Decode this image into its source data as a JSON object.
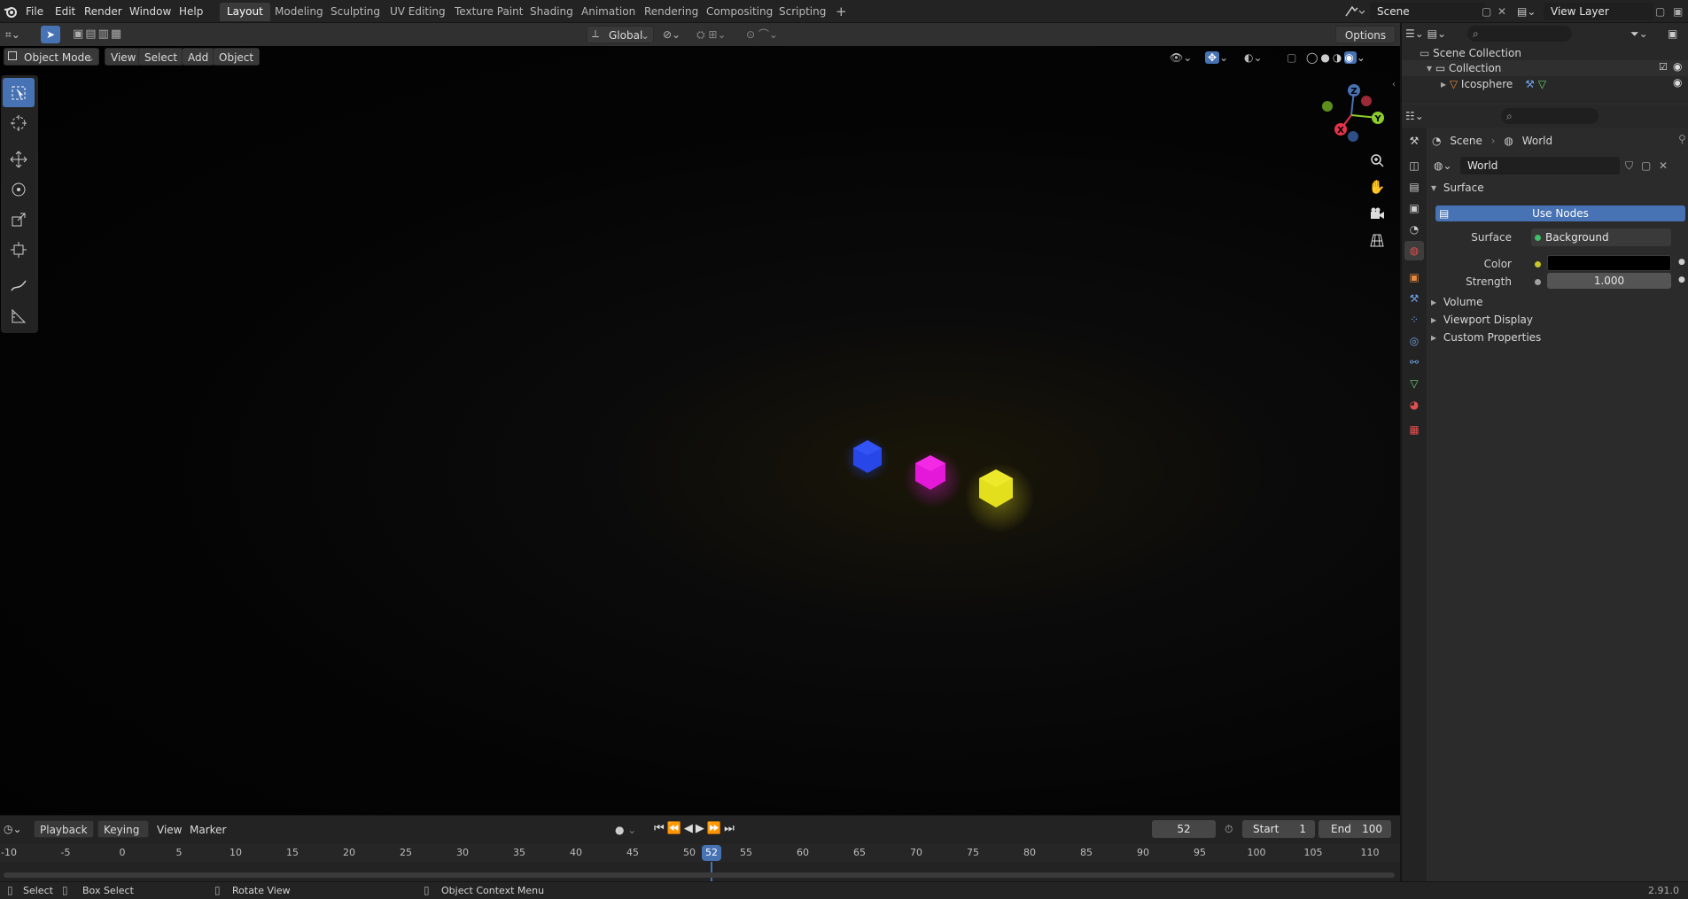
{
  "menubar": {
    "items": [
      "File",
      "Edit",
      "Render",
      "Window",
      "Help"
    ],
    "workspaces": [
      "Layout",
      "Modeling",
      "Sculpting",
      "UV Editing",
      "Texture Paint",
      "Shading",
      "Animation",
      "Rendering",
      "Compositing",
      "Scripting"
    ],
    "add_tab": "+",
    "scene_name": "Scene",
    "view_layer": "View Layer"
  },
  "viewport_header": {
    "mode": "Object Mode",
    "menus": [
      "View",
      "Select",
      "Add",
      "Object"
    ],
    "transform_orientation": "Global",
    "options": "Options"
  },
  "gizmo": {
    "x": "X",
    "y": "Y",
    "z": "Z"
  },
  "objects": [
    {
      "name": "blue-sphere",
      "color": "#2747e8"
    },
    {
      "name": "magenta-sphere",
      "color": "#e418d8"
    },
    {
      "name": "yellow-sphere",
      "color": "#e4df1c"
    }
  ],
  "outliner": {
    "scene_collection": "Scene Collection",
    "collection": "Collection",
    "object": "Icosphere"
  },
  "properties": {
    "breadcrumb_scene": "Scene",
    "breadcrumb_world": "World",
    "world_name": "World",
    "surface_panel": "Surface",
    "use_nodes": "Use Nodes",
    "surface_label": "Surface",
    "surface_value": "Background",
    "color_label": "Color",
    "color_value": "#000000",
    "strength_label": "Strength",
    "strength_value": "1.000",
    "collapsed_panels": [
      "Volume",
      "Viewport Display",
      "Custom Properties"
    ]
  },
  "timeline": {
    "menus": [
      "Playback",
      "Keying",
      "View",
      "Marker"
    ],
    "current_frame": "52",
    "start_label": "Start",
    "start_value": "1",
    "end_label": "End",
    "end_value": "100",
    "ruler": [
      "-10",
      "-5",
      "0",
      "5",
      "10",
      "15",
      "20",
      "25",
      "30",
      "35",
      "40",
      "45",
      "50",
      "52",
      "55",
      "60",
      "65",
      "70",
      "75",
      "80",
      "85",
      "90",
      "95",
      "100",
      "105",
      "110"
    ]
  },
  "statusbar": {
    "select": "Select",
    "box_select": "Box Select",
    "rotate_view": "Rotate View",
    "context_menu": "Object Context Menu",
    "version": "2.91.0"
  },
  "colors": {
    "accent": "#4772b3",
    "bg": "#1d1d1d"
  }
}
